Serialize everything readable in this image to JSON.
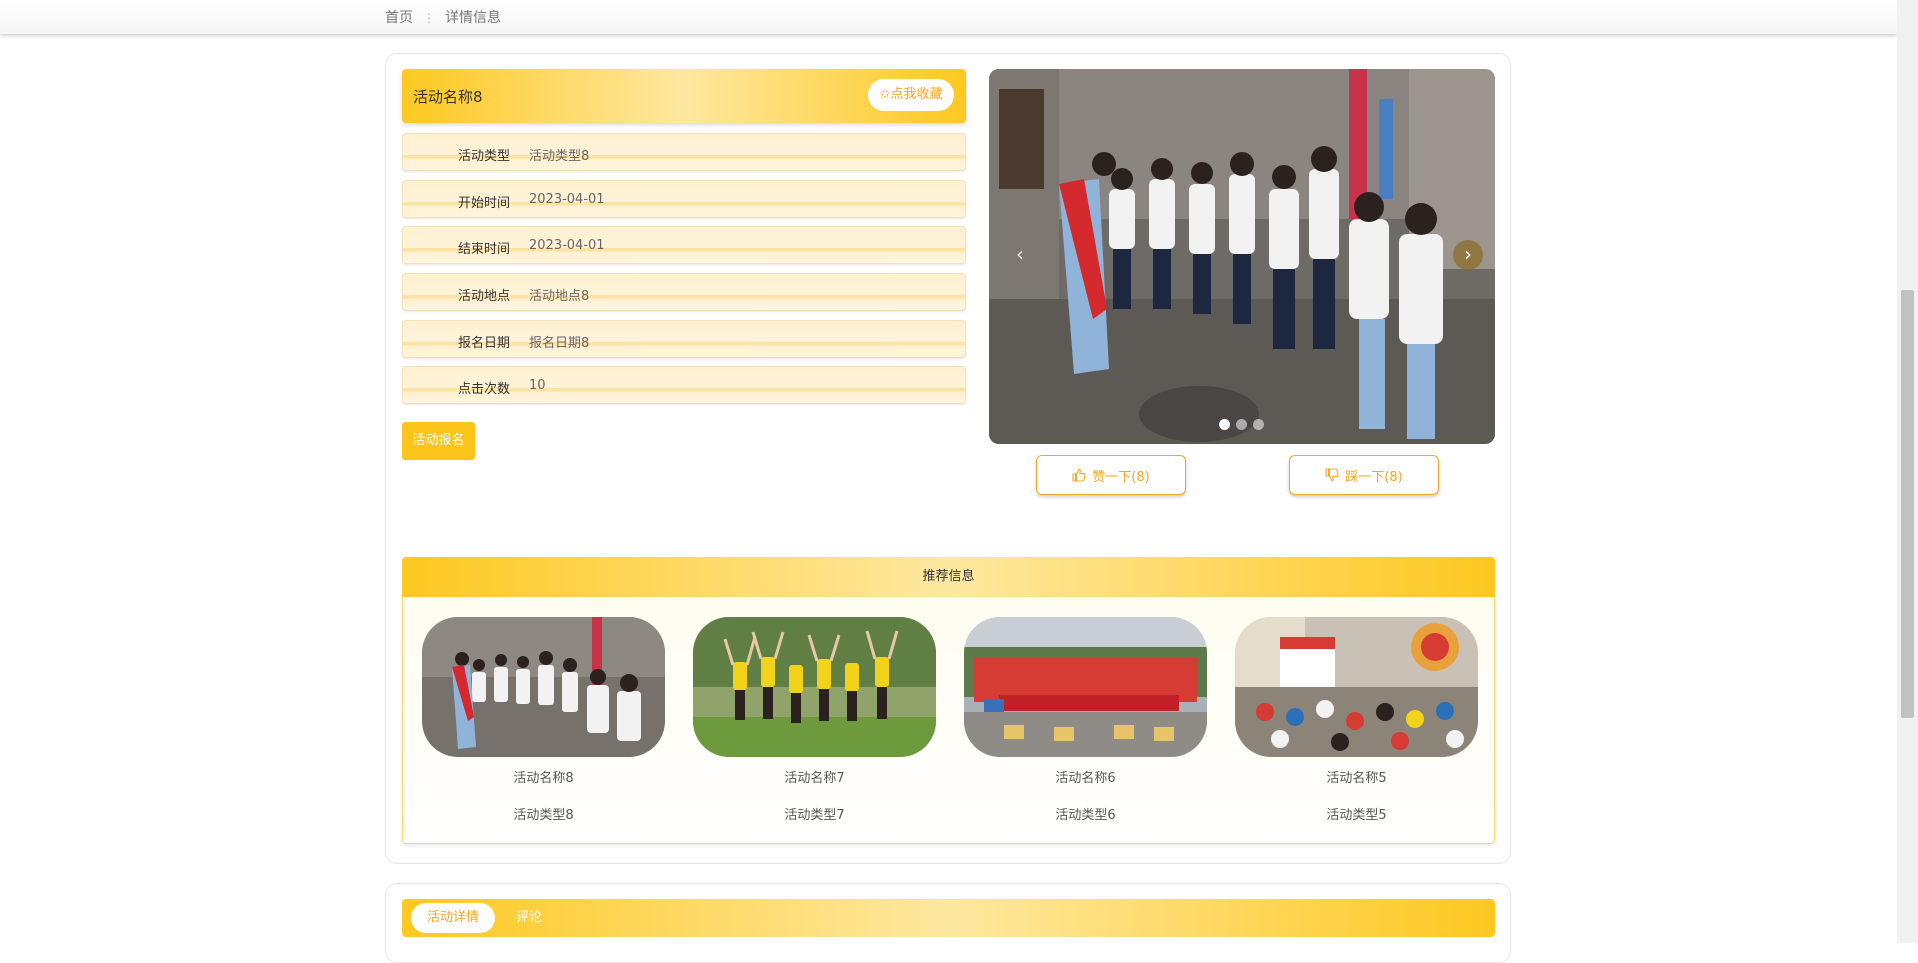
{
  "breadcrumb": {
    "home": "首页",
    "separator": "⋮",
    "current": "详情信息"
  },
  "detail": {
    "title": "活动名称8",
    "favorite_label": "✩点我收藏",
    "fields": [
      {
        "label": "活动类型",
        "value": "活动类型8"
      },
      {
        "label": "开始时间",
        "value": "2023-04-01"
      },
      {
        "label": "结束时间",
        "value": "2023-04-01"
      },
      {
        "label": "活动地点",
        "value": "活动地点8"
      },
      {
        "label": "报名日期",
        "value": "报名日期8"
      },
      {
        "label": "点击次数",
        "value": "10"
      }
    ],
    "signup_label": "活动报名"
  },
  "carousel": {
    "prev_icon": "‹",
    "next_icon": "›",
    "slide_count": 3,
    "active_index": 0
  },
  "votes": {
    "like_label": "赞一下(8)",
    "dislike_label": "踩一下(8)"
  },
  "recommend": {
    "title": "推荐信息",
    "items": [
      {
        "name": "活动名称8",
        "type": "活动类型8"
      },
      {
        "name": "活动名称7",
        "type": "活动类型7"
      },
      {
        "name": "活动名称6",
        "type": "活动类型6"
      },
      {
        "name": "活动名称5",
        "type": "活动类型5"
      }
    ]
  },
  "tabs": [
    {
      "label": "活动详情"
    },
    {
      "label": "评论"
    }
  ],
  "colors": {
    "accent": "#fdc41a",
    "accent_text": "#f5a623",
    "bar_light": "#fee8a0"
  }
}
